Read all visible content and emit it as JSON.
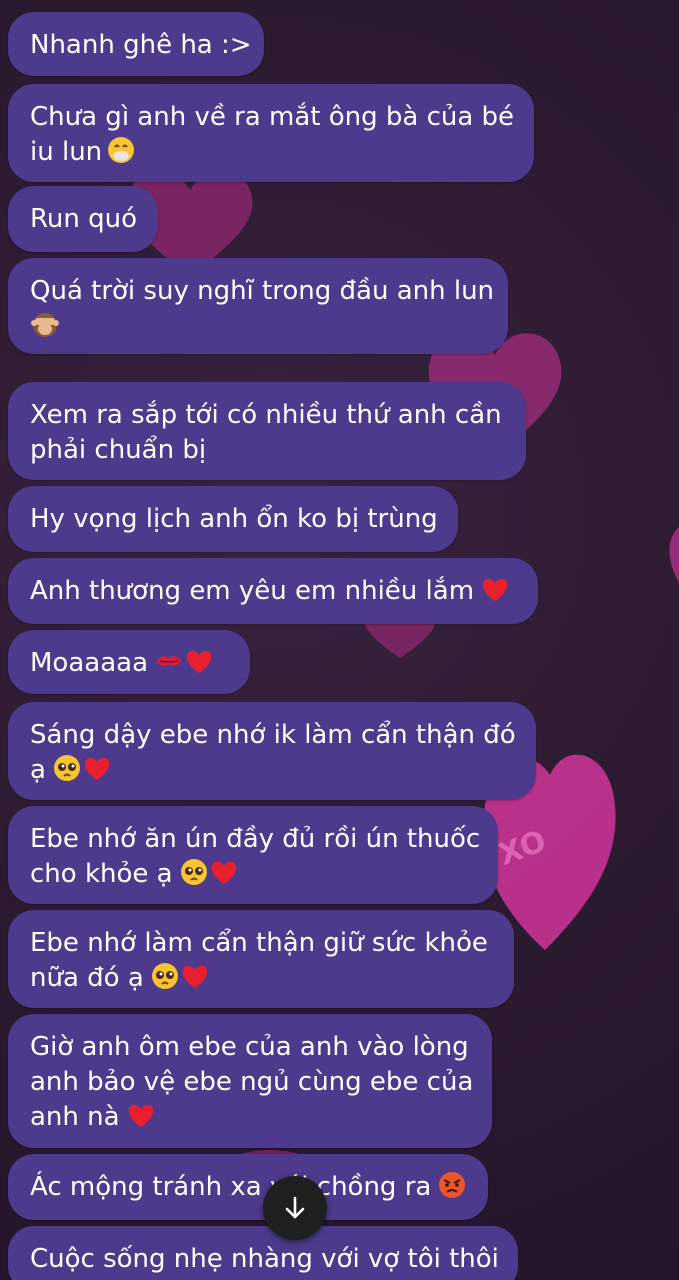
{
  "messages": [
    {
      "lines": [
        "Nhanh ghê ha :>"
      ],
      "emoji": []
    },
    {
      "lines": [
        "Chưa gì anh về ra mắt ông bà của bé",
        "iu lun"
      ],
      "emoji": [
        "face-with-hand-over-mouth-emoji"
      ]
    },
    {
      "lines": [
        "Run quó"
      ],
      "emoji": []
    },
    {
      "lines": [
        "Quá trời suy nghĩ trong đầu anh lun",
        ""
      ],
      "emoji": [
        "see-no-evil-monkey-emoji"
      ]
    },
    {
      "lines": [
        "Xem ra sắp tới có nhiều thứ anh cần",
        "phải chuẩn bị"
      ],
      "emoji": []
    },
    {
      "lines": [
        "Hy vọng lịch anh ổn ko bị trùng"
      ],
      "emoji": []
    },
    {
      "lines": [
        "Anh thương em yêu em nhiều lắm"
      ],
      "emoji": [
        "red-heart-emoji"
      ]
    },
    {
      "lines": [
        "Moaaaaa"
      ],
      "emoji": [
        "kiss-mark-emoji",
        "red-heart-emoji"
      ]
    },
    {
      "lines": [
        "Sáng dậy ebe nhớ ik làm cẩn thận đó",
        "ạ"
      ],
      "emoji": [
        "pleading-face-emoji",
        "red-heart-emoji"
      ]
    },
    {
      "lines": [
        "Ebe nhớ ăn ún đầy đủ rồi ún thuốc",
        "cho khỏe ạ"
      ],
      "emoji": [
        "pleading-face-emoji",
        "red-heart-emoji"
      ]
    },
    {
      "lines": [
        "Ebe nhớ làm cẩn thận giữ sức khỏe",
        "nữa đó ạ"
      ],
      "emoji": [
        "pleading-face-emoji",
        "red-heart-emoji"
      ]
    },
    {
      "lines": [
        "Giờ anh ôm ebe của anh vào lòng",
        "anh bảo vệ ebe ngủ cùng ebe của",
        "anh nà"
      ],
      "emoji": [
        "red-heart-emoji"
      ]
    },
    {
      "lines": [
        "Ác mộng tránh xa với chồng ra"
      ],
      "emoji": [
        "angry-face-emoji"
      ]
    },
    {
      "lines": [
        "Cuộc sống nhẹ nhàng với vợ tôi thôi"
      ],
      "emoji": []
    }
  ],
  "scroll_button": {
    "icon": "arrow-down-icon"
  },
  "colors": {
    "bubble": "#4e3a8c",
    "background": "#2b1a30",
    "heart_decoration": "#d1359a",
    "scroll_button": "#1f1f1f"
  }
}
